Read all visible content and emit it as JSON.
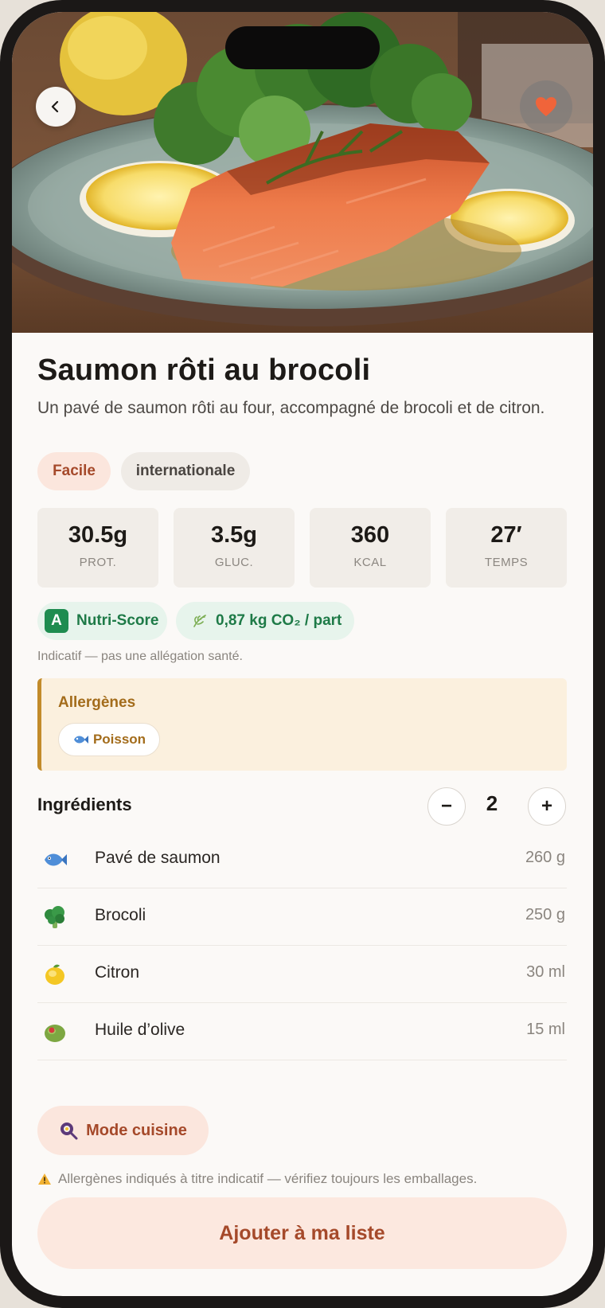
{
  "recipe": {
    "title": "Saumon rôti au brocoli",
    "description": "Un pavé de saumon rôti au four, accompagné de brocoli et de citron.",
    "tags": {
      "difficulty": "Facile",
      "cuisine": "internationale"
    },
    "favorite": true
  },
  "stats": [
    {
      "value": "30.5g",
      "label": "PROT."
    },
    {
      "value": "3.5g",
      "label": "GLUC."
    },
    {
      "value": "360",
      "label": "KCAL"
    },
    {
      "value": "27′",
      "label": "TEMPS"
    }
  ],
  "badges": {
    "nutri_grade": "A",
    "nutri_label": "Nutri-Score",
    "co2_label": "0,87 kg CO₂ / part"
  },
  "note": "Indicatif — pas une allégation santé.",
  "allergens": {
    "title": "Allergènes",
    "items": [
      {
        "label": "Poisson",
        "icon": "fish-icon"
      }
    ]
  },
  "ingredients": {
    "title": "Ingrédients",
    "servings": "2",
    "minus": "−",
    "plus": "+",
    "items": [
      {
        "name": "Pavé de saumon",
        "qty": "260 g",
        "icon": "fish-icon"
      },
      {
        "name": "Brocoli",
        "qty": "250 g",
        "icon": "broccoli-icon"
      },
      {
        "name": "Citron",
        "qty": "30 ml",
        "icon": "lemon-icon"
      },
      {
        "name": "Huile d’olive",
        "qty": "15 ml",
        "icon": "olive-icon"
      }
    ]
  },
  "cook_mode_label": "Mode cuisine",
  "warning": "Allergènes indiqués à titre indicatif — vérifiez toujours les emballages.",
  "add_to_list_label": "Ajouter à ma liste",
  "colors": {
    "accent": "#a5492a",
    "accent_bg": "#fbe6dd",
    "green": "#1e7a47",
    "allergen": "#a36c1b"
  }
}
